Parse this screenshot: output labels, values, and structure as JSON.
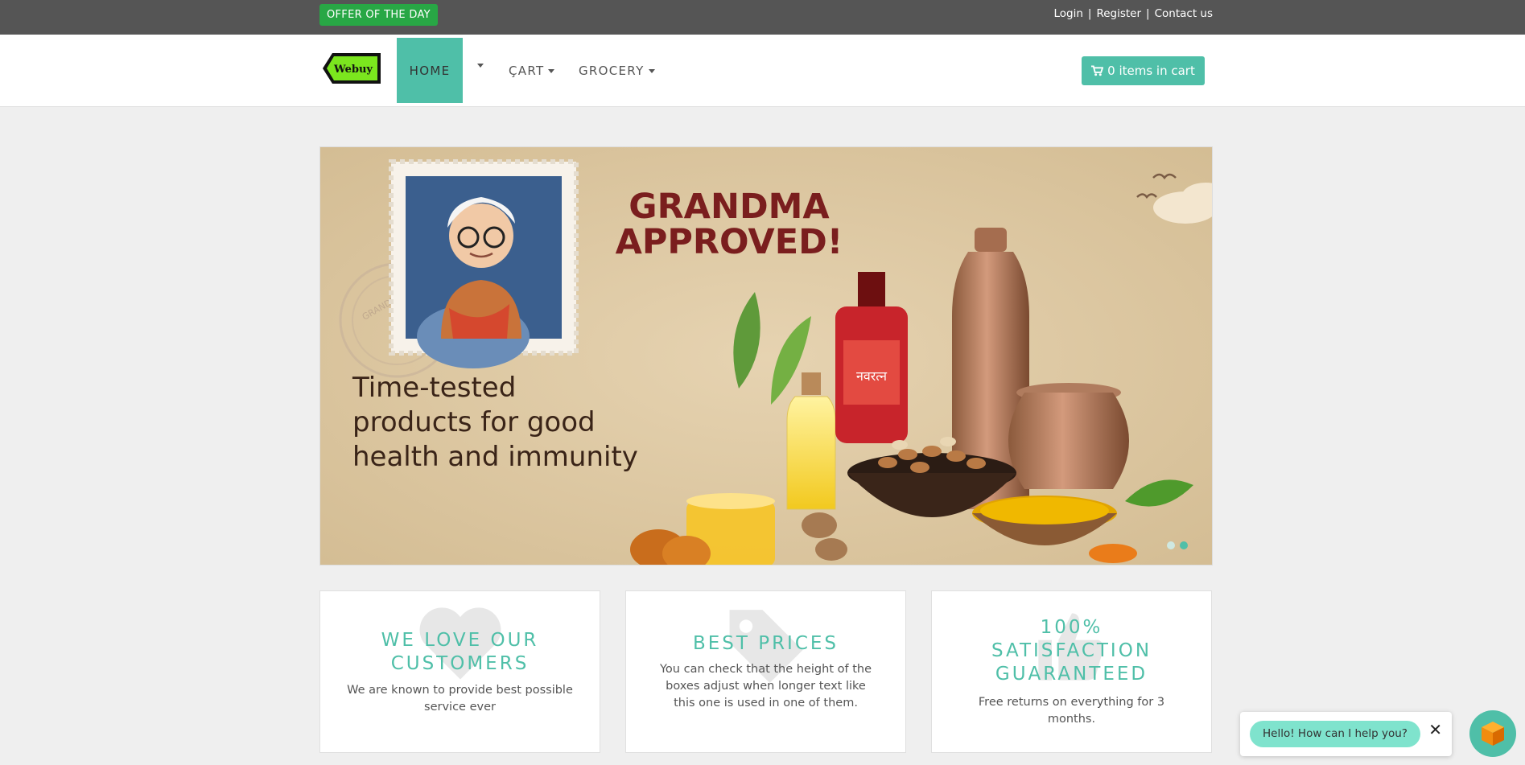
{
  "topbar": {
    "offer_label": "OFFER OF THE DAY",
    "links": [
      "Login",
      "Register",
      "Contact us"
    ],
    "separator": "|"
  },
  "nav": {
    "logo_text": "Webuy",
    "home_label": "HOME",
    "cart_menu_label": "ÇART",
    "grocery_menu_label": "GROCERY",
    "cart_button_label": "0 items in cart"
  },
  "carousel": {
    "headline_1": "GRANDMA",
    "headline_2": "APPROVED!",
    "tagline_1": "Time-tested",
    "tagline_2": "products for good",
    "tagline_3": "health and immunity",
    "stamp_text": "GRANDMA APPROVED",
    "bottle_label": "नवरत्न",
    "active_slide": 2,
    "slide_count": 2
  },
  "features": [
    {
      "title_1": "WE LOVE OUR",
      "title_2": "CUSTOMERS",
      "text": "We are known to provide best possible service ever",
      "icon": "heart-icon"
    },
    {
      "title_1": "BEST PRICES",
      "text": "You can check that the height of the boxes adjust when longer text like this one is used in one of them.",
      "icon": "tag-icon"
    },
    {
      "title_1": "100%",
      "title_2": "SATISFACTION",
      "title_3": "GUARANTEED",
      "text": "Free returns on everything for 3 months.",
      "icon": "thumbs-up-icon"
    }
  ],
  "chat": {
    "greeting": "Hello! How can I help you?",
    "close_symbol": "✕"
  },
  "colors": {
    "accent": "#4fbfa8",
    "topbar": "#555555",
    "offer": "#28a745"
  }
}
